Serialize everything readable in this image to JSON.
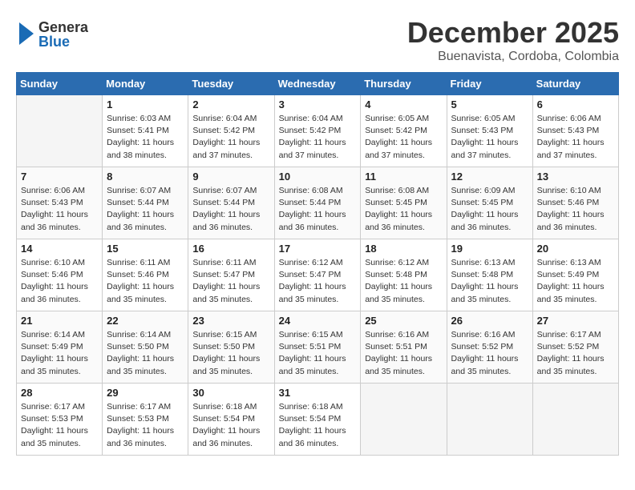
{
  "logo": {
    "line1": "General",
    "line2": "Blue"
  },
  "title": "December 2025",
  "subtitle": "Buenavista, Cordoba, Colombia",
  "days_header": [
    "Sunday",
    "Monday",
    "Tuesday",
    "Wednesday",
    "Thursday",
    "Friday",
    "Saturday"
  ],
  "weeks": [
    [
      {
        "day": "",
        "info": ""
      },
      {
        "day": "1",
        "info": "Sunrise: 6:03 AM\nSunset: 5:41 PM\nDaylight: 11 hours\nand 38 minutes."
      },
      {
        "day": "2",
        "info": "Sunrise: 6:04 AM\nSunset: 5:42 PM\nDaylight: 11 hours\nand 37 minutes."
      },
      {
        "day": "3",
        "info": "Sunrise: 6:04 AM\nSunset: 5:42 PM\nDaylight: 11 hours\nand 37 minutes."
      },
      {
        "day": "4",
        "info": "Sunrise: 6:05 AM\nSunset: 5:42 PM\nDaylight: 11 hours\nand 37 minutes."
      },
      {
        "day": "5",
        "info": "Sunrise: 6:05 AM\nSunset: 5:43 PM\nDaylight: 11 hours\nand 37 minutes."
      },
      {
        "day": "6",
        "info": "Sunrise: 6:06 AM\nSunset: 5:43 PM\nDaylight: 11 hours\nand 37 minutes."
      }
    ],
    [
      {
        "day": "7",
        "info": "Sunrise: 6:06 AM\nSunset: 5:43 PM\nDaylight: 11 hours\nand 36 minutes."
      },
      {
        "day": "8",
        "info": "Sunrise: 6:07 AM\nSunset: 5:44 PM\nDaylight: 11 hours\nand 36 minutes."
      },
      {
        "day": "9",
        "info": "Sunrise: 6:07 AM\nSunset: 5:44 PM\nDaylight: 11 hours\nand 36 minutes."
      },
      {
        "day": "10",
        "info": "Sunrise: 6:08 AM\nSunset: 5:44 PM\nDaylight: 11 hours\nand 36 minutes."
      },
      {
        "day": "11",
        "info": "Sunrise: 6:08 AM\nSunset: 5:45 PM\nDaylight: 11 hours\nand 36 minutes."
      },
      {
        "day": "12",
        "info": "Sunrise: 6:09 AM\nSunset: 5:45 PM\nDaylight: 11 hours\nand 36 minutes."
      },
      {
        "day": "13",
        "info": "Sunrise: 6:10 AM\nSunset: 5:46 PM\nDaylight: 11 hours\nand 36 minutes."
      }
    ],
    [
      {
        "day": "14",
        "info": "Sunrise: 6:10 AM\nSunset: 5:46 PM\nDaylight: 11 hours\nand 36 minutes."
      },
      {
        "day": "15",
        "info": "Sunrise: 6:11 AM\nSunset: 5:46 PM\nDaylight: 11 hours\nand 35 minutes."
      },
      {
        "day": "16",
        "info": "Sunrise: 6:11 AM\nSunset: 5:47 PM\nDaylight: 11 hours\nand 35 minutes."
      },
      {
        "day": "17",
        "info": "Sunrise: 6:12 AM\nSunset: 5:47 PM\nDaylight: 11 hours\nand 35 minutes."
      },
      {
        "day": "18",
        "info": "Sunrise: 6:12 AM\nSunset: 5:48 PM\nDaylight: 11 hours\nand 35 minutes."
      },
      {
        "day": "19",
        "info": "Sunrise: 6:13 AM\nSunset: 5:48 PM\nDaylight: 11 hours\nand 35 minutes."
      },
      {
        "day": "20",
        "info": "Sunrise: 6:13 AM\nSunset: 5:49 PM\nDaylight: 11 hours\nand 35 minutes."
      }
    ],
    [
      {
        "day": "21",
        "info": "Sunrise: 6:14 AM\nSunset: 5:49 PM\nDaylight: 11 hours\nand 35 minutes."
      },
      {
        "day": "22",
        "info": "Sunrise: 6:14 AM\nSunset: 5:50 PM\nDaylight: 11 hours\nand 35 minutes."
      },
      {
        "day": "23",
        "info": "Sunrise: 6:15 AM\nSunset: 5:50 PM\nDaylight: 11 hours\nand 35 minutes."
      },
      {
        "day": "24",
        "info": "Sunrise: 6:15 AM\nSunset: 5:51 PM\nDaylight: 11 hours\nand 35 minutes."
      },
      {
        "day": "25",
        "info": "Sunrise: 6:16 AM\nSunset: 5:51 PM\nDaylight: 11 hours\nand 35 minutes."
      },
      {
        "day": "26",
        "info": "Sunrise: 6:16 AM\nSunset: 5:52 PM\nDaylight: 11 hours\nand 35 minutes."
      },
      {
        "day": "27",
        "info": "Sunrise: 6:17 AM\nSunset: 5:52 PM\nDaylight: 11 hours\nand 35 minutes."
      }
    ],
    [
      {
        "day": "28",
        "info": "Sunrise: 6:17 AM\nSunset: 5:53 PM\nDaylight: 11 hours\nand 35 minutes."
      },
      {
        "day": "29",
        "info": "Sunrise: 6:17 AM\nSunset: 5:53 PM\nDaylight: 11 hours\nand 36 minutes."
      },
      {
        "day": "30",
        "info": "Sunrise: 6:18 AM\nSunset: 5:54 PM\nDaylight: 11 hours\nand 36 minutes."
      },
      {
        "day": "31",
        "info": "Sunrise: 6:18 AM\nSunset: 5:54 PM\nDaylight: 11 hours\nand 36 minutes."
      },
      {
        "day": "",
        "info": ""
      },
      {
        "day": "",
        "info": ""
      },
      {
        "day": "",
        "info": ""
      }
    ]
  ]
}
